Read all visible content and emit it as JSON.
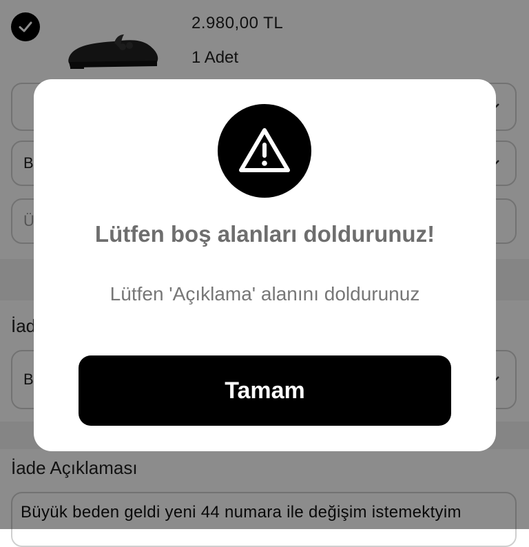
{
  "product": {
    "price": "2.980,00 TL",
    "quantity": "1 Adet",
    "selected_icon": "check-icon",
    "image_icon": "shoe-image"
  },
  "form": {
    "select_1_text": "",
    "select_2_text": "B",
    "input_3_placeholder": "Ü",
    "iade_label_partial": "İad",
    "select_4_text": "B",
    "description_label": "İade Açıklaması",
    "description_value": "Büyük beden geldi yeni 44 numara ile değişim istemektyim"
  },
  "dialog": {
    "icon": "warning-icon",
    "title": "Lütfen boş alanları doldurunuz!",
    "message": "Lütfen 'Açıklama' alanını doldurunuz",
    "ok_label": "Tamam"
  }
}
